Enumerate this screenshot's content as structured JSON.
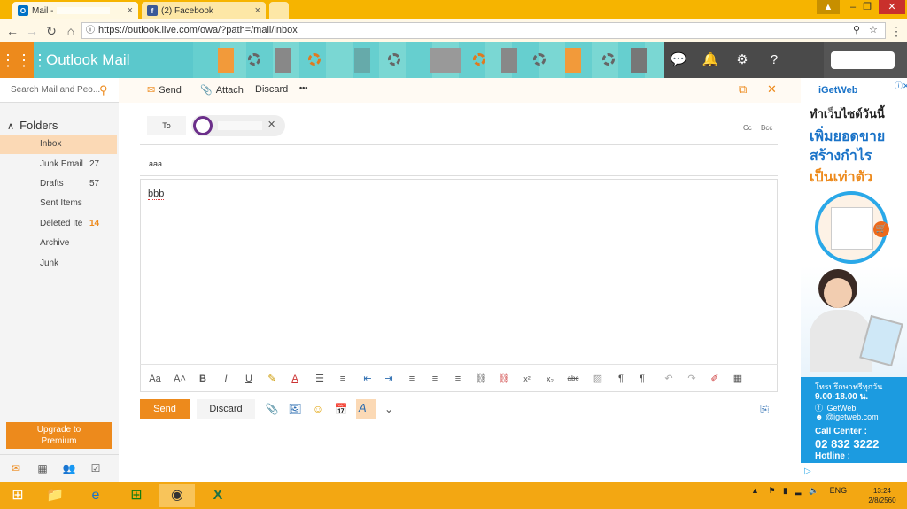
{
  "browser": {
    "tabs": [
      {
        "label": "Mail - ",
        "icon": "outlook-icon"
      },
      {
        "label": "(2) Facebook",
        "icon": "facebook-icon"
      }
    ],
    "url": "https://outlook.live.com/owa/?path=/mail/inbox"
  },
  "app": {
    "title": "Outlook Mail"
  },
  "search": {
    "placeholder": "Search Mail and Peo..."
  },
  "folders": {
    "header": "Folders",
    "items": [
      {
        "label": "Inbox",
        "count": ""
      },
      {
        "label": "Junk Email",
        "count": "27"
      },
      {
        "label": "Drafts",
        "count": "57"
      },
      {
        "label": "Sent Items",
        "count": ""
      },
      {
        "label": "Deleted Ite",
        "count": "14"
      },
      {
        "label": "Archive",
        "count": ""
      },
      {
        "label": "Junk",
        "count": ""
      }
    ]
  },
  "upgrade": {
    "line1": "Upgrade to",
    "line2": "Premium"
  },
  "commandbar": {
    "send": "Send",
    "attach": "Attach",
    "discard": "Discard",
    "more": "•••"
  },
  "compose": {
    "to_label": "To",
    "cc": "Cc",
    "bcc": "Bcc",
    "subject": "aaa",
    "body": "bbb",
    "send_button": "Send",
    "discard_button": "Discard"
  },
  "ad": {
    "brand": "iGetWeb",
    "line1": "ทำเว็บไซต์วันนี้",
    "line2": "เพิ่มยอดขาย",
    "line3": "สร้างกำไร",
    "line4": "เป็นเท่าตัว",
    "consult": "โทรปรึกษาฟรีทุกวัน",
    "hours": "9.00-18.00 น.",
    "facebook": "iGetWeb",
    "line_id": "@igetweb.com",
    "callcenter_label": "Call Center :",
    "phone": "02 832 3222",
    "hotline_label": "Hotline :"
  },
  "taskbar": {
    "lang": "ENG",
    "time": "13:24",
    "date": "2/8/2560"
  },
  "colors": {
    "accent": "#ed8a1c",
    "header": "#5bc8cc",
    "selected": "#fbd9b5"
  }
}
